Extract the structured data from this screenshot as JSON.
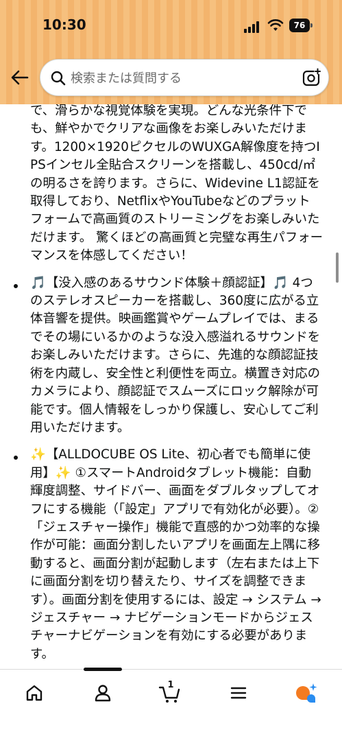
{
  "status_bar": {
    "time": "10:30",
    "battery": "76"
  },
  "search": {
    "placeholder": "検索または質問する"
  },
  "product": {
    "bullets": [
      {
        "text": "で、滑らかな視覚体験を実現。どんな光条件下でも、鮮やかでクリアな画像をお楽しみいただけます。1200×1920ピクセルのWUXGA解像度を持つIPSインセル全貼合スクリーンを搭載し、450cd/㎡の明るさを誇ります。さらに、Widevine L1認証を取得しており、NetflixやYouTubeなどのプラットフォームで高画質のストリーミングをお楽しみいただけます。 驚くほどの高画質と完璧な再生パフォーマンスを体感してください！"
      },
      {
        "text": "🎵【没入感のあるサウンド体験＋顔認証】🎵 4つのステレオスピーカーを搭載し、360度に広がる立体音響を提供。映画鑑賞やゲームプレイでは、まるでその場にいるかのような没入感溢れるサウンドをお楽しみいただけます。さらに、先進的な顔認証技術を内蔵し、安全性と利便性を両立。横置き対応のカメラにより、顔認証でスムーズにロック解除が可能です。個人情報をしっかり保護し、安心してご利用いただけます。"
      },
      {
        "text": "✨【ALLDOCUBE OS Lite、初心者でも簡単に使用】✨ ①スマートAndroidタブレット機能：自動輝度調整、サイドバー、画面をダブルタップしてオフにする機能（「設定」アプリで有効化が必要）。②「ジェスチャー操作」機能で直感的かつ効率的な操作が可能：画面分割したいアプリを画面左上隅に移動すると、画面分割が起動します（左右または上下に画面分割を切り替えたり、サイズを調整できます）。画面分割を使用するには、設定 → システム → ジェスチャー → ナビゲーションモードからジェスチャーナビゲーションを有効にする必要があります。"
      }
    ]
  },
  "tabbar": {
    "cart_count": "1",
    "items": [
      "home-icon",
      "account-icon",
      "cart-icon",
      "menu-icon",
      "rufus-icon"
    ]
  },
  "colors": {
    "header_bg": "#f6c07e",
    "rufus_orange": "#f47b20",
    "rufus_blue": "#2a8df0"
  }
}
